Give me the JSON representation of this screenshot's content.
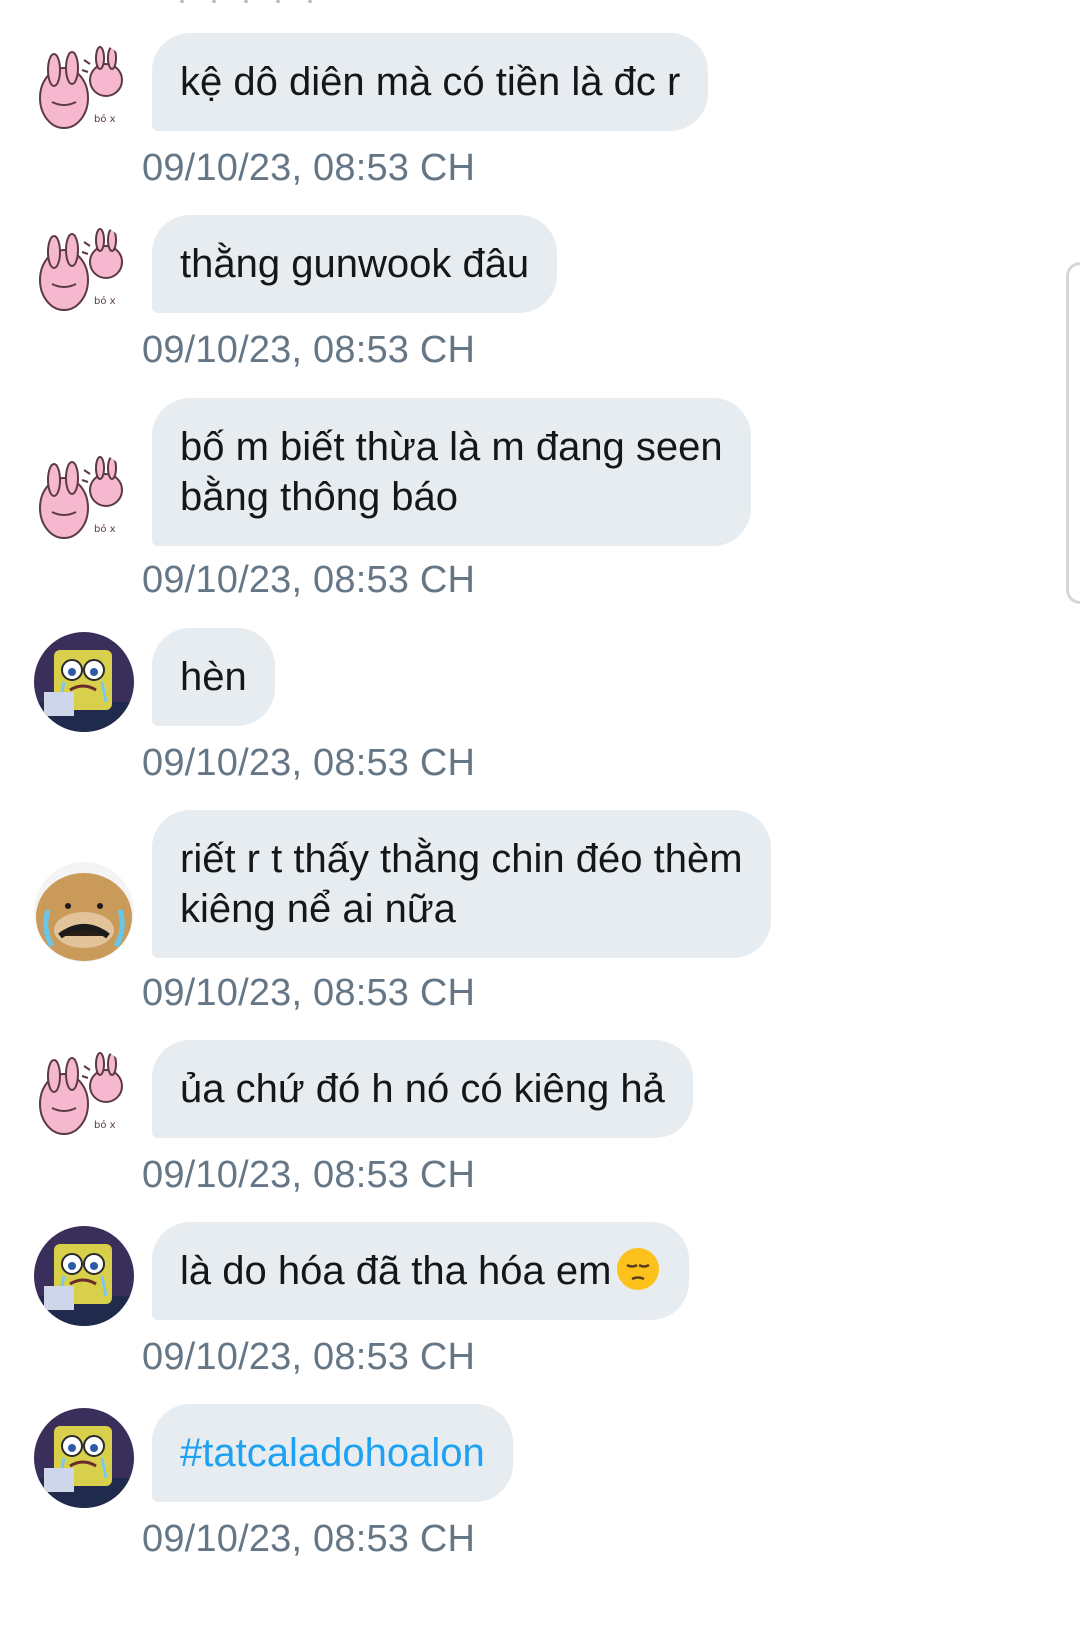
{
  "messages": [
    {
      "avatar": "bunny-sticker-avatar",
      "text": "kệ dô diên mà có tiền là đc r",
      "time": "09/10/23, 08:53 CH"
    },
    {
      "avatar": "bunny-sticker-avatar",
      "text": "thằng gunwook đâu",
      "time": "09/10/23, 08:53 CH"
    },
    {
      "avatar": "bunny-sticker-avatar",
      "text": "bố m biết thừa là m đang seen\nbằng thông báo",
      "time": "09/10/23, 08:53 CH"
    },
    {
      "avatar": "crying-sponge-avatar",
      "text": "hèn",
      "time": "09/10/23, 08:53 CH"
    },
    {
      "avatar": "crying-dog-avatar",
      "text": "riết r t thấy thằng chin đéo thèm\nkiêng nể ai nữa",
      "time": "09/10/23, 08:53 CH"
    },
    {
      "avatar": "bunny-sticker-avatar",
      "text": "ủa chứ đó h nó có kiêng hả",
      "time": "09/10/23, 08:53 CH"
    },
    {
      "avatar": "crying-sponge-avatar",
      "text": "là do hóa đã tha hóa em",
      "emoji": "pensive-face-icon",
      "time": "09/10/23, 08:53 CH"
    },
    {
      "avatar": "crying-sponge-avatar",
      "text": "#tatcaladohoalon",
      "link": true,
      "time": "09/10/23, 08:53 CH"
    }
  ]
}
